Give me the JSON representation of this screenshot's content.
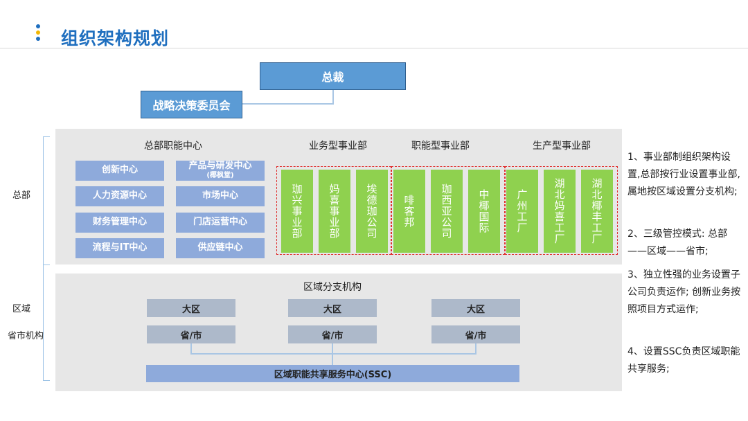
{
  "title": "组织架构规划",
  "colors": {
    "accent": "#1f6fbf",
    "green": "#8fd14f",
    "box": "#8eaadb",
    "region": "#adb9ca"
  },
  "top": {
    "president": "总裁",
    "committee": "战略决策委员会"
  },
  "hq": {
    "label": "总部",
    "functions": {
      "header": "总部职能中心",
      "left": [
        "创新中心",
        "人力资源中心",
        "财务管理中心",
        "流程与IT中心"
      ],
      "right_first": {
        "line1": "产品与研发中心",
        "line2": "(椰枫堂)"
      },
      "right": [
        "市场中心",
        "门店运营中心",
        "供应链中心"
      ]
    },
    "divisions": [
      {
        "header": "业务型事业部",
        "units": [
          "珈兴事业部",
          "妈喜事业部",
          "埃德珈公司"
        ]
      },
      {
        "header": "职能型事业部",
        "units": [
          "啡客邦",
          "珈西亚公司",
          "中椰国际"
        ]
      },
      {
        "header": "生产型事业部",
        "units": [
          "广州工厂",
          "湖北妈喜工厂",
          "湖北椰丰工厂"
        ]
      }
    ]
  },
  "regional": {
    "header": "区域分支机构",
    "label_region": "区域",
    "label_province": "省市机构",
    "columns": [
      {
        "region": "大区",
        "province": "省/市"
      },
      {
        "region": "大区",
        "province": "省/市"
      },
      {
        "region": "大区",
        "province": "省/市"
      }
    ],
    "ssc": "区域职能共享服务中心(SSC)"
  },
  "notes": [
    "1、事业部制组织架构设置,总部按行业设置事业部,属地按区域设置分支机构;",
    "2、三级管控模式: 总部——区域——省市;",
    "3、独立性强的业务设置子公司负责运作; 创新业务按照项目方式运作;",
    "4、设置SSC负责区域职能共享服务;"
  ]
}
